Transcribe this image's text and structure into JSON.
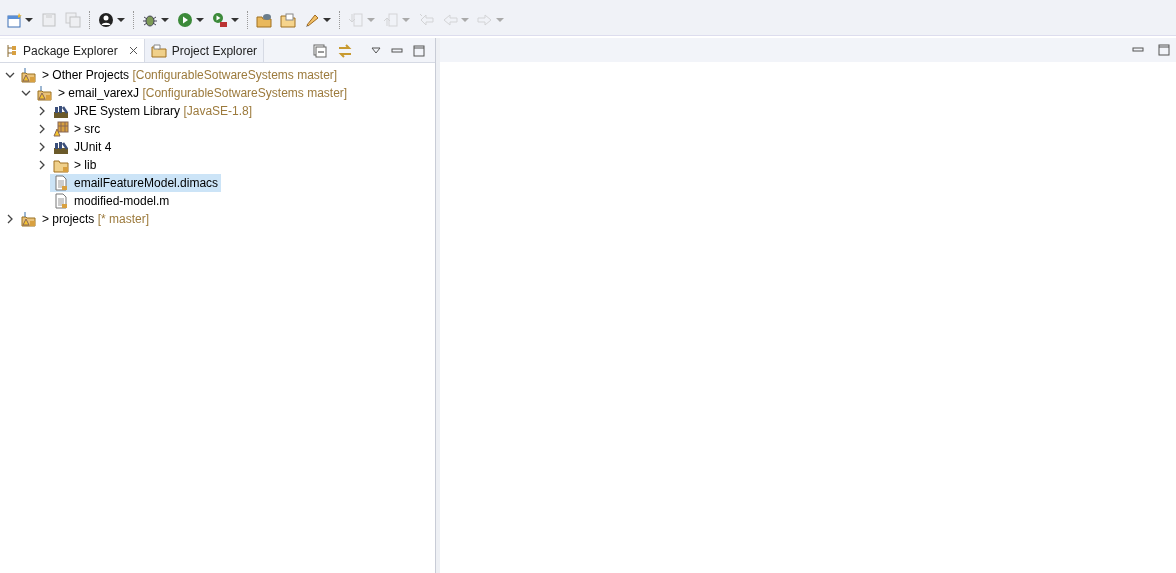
{
  "toolbar": [
    {
      "kind": "new",
      "disabled": false,
      "dropdown": true
    },
    {
      "kind": "save",
      "disabled": true,
      "dropdown": false
    },
    {
      "kind": "save-all",
      "disabled": true,
      "dropdown": false
    },
    {
      "kind": "sep"
    },
    {
      "kind": "person",
      "disabled": false,
      "dropdown": true
    },
    {
      "kind": "sep"
    },
    {
      "kind": "debug",
      "disabled": false,
      "dropdown": true
    },
    {
      "kind": "run",
      "disabled": false,
      "dropdown": true
    },
    {
      "kind": "run-tool",
      "disabled": false,
      "dropdown": true
    },
    {
      "kind": "sep"
    },
    {
      "kind": "open-project",
      "disabled": false,
      "dropdown": false
    },
    {
      "kind": "open-folder",
      "disabled": false,
      "dropdown": false
    },
    {
      "kind": "marker",
      "disabled": false,
      "dropdown": true
    },
    {
      "kind": "sep"
    },
    {
      "kind": "next",
      "disabled": true,
      "dropdown": true
    },
    {
      "kind": "prev",
      "disabled": true,
      "dropdown": true
    },
    {
      "kind": "last-edit",
      "disabled": true,
      "dropdown": false
    },
    {
      "kind": "back",
      "disabled": true,
      "dropdown": true
    },
    {
      "kind": "forward",
      "disabled": true,
      "dropdown": true
    }
  ],
  "tabs": [
    {
      "label": "Package Explorer",
      "selected": true
    },
    {
      "label": "Project Explorer",
      "selected": false
    }
  ],
  "tree": [
    {
      "kind": "project",
      "prefix": ">",
      "label": "Other Projects",
      "decoration": "[ConfigurableSotwareSystems master]",
      "expanded": true,
      "selected": false,
      "children": [
        {
          "kind": "project",
          "prefix": ">",
          "label": "email_varexJ",
          "decoration": "[ConfigurableSotwareSystems master]",
          "expanded": true,
          "selected": false,
          "children": [
            {
              "kind": "library",
              "label": "JRE System Library",
              "decoration": "[JavaSE-1.8]",
              "expanded": false,
              "selected": false
            },
            {
              "kind": "package",
              "prefix": ">",
              "label": "src",
              "expanded": false,
              "selected": false
            },
            {
              "kind": "library",
              "label": "JUnit 4",
              "expanded": false,
              "selected": false
            },
            {
              "kind": "folder",
              "prefix": ">",
              "label": "lib",
              "expanded": false,
              "selected": false
            },
            {
              "kind": "file",
              "label": "emailFeatureModel.dimacs",
              "selected": true
            },
            {
              "kind": "file",
              "label": "modified-model.m",
              "selected": false
            }
          ]
        }
      ]
    },
    {
      "kind": "project",
      "prefix": ">",
      "label": "projects",
      "decoration": "[* master]",
      "expanded": false,
      "selected": false
    }
  ]
}
